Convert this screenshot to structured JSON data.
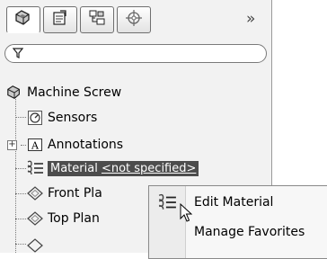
{
  "tabs": [
    {
      "icon": "feature-manager-icon",
      "active": true
    },
    {
      "icon": "property-manager-icon",
      "active": false
    },
    {
      "icon": "configuration-manager-icon",
      "active": false
    },
    {
      "icon": "dim-xpert-icon",
      "active": false
    }
  ],
  "overflow_label": "»",
  "filter": {
    "icon": "filter-icon",
    "value": ""
  },
  "tree": {
    "root": "Machine Screw",
    "items": [
      {
        "label": "Sensors",
        "icon": "sensors-icon"
      },
      {
        "label": "Annotations",
        "icon": "annotations-icon"
      },
      {
        "label": "Material",
        "suffix": "<not specified>",
        "icon": "material-icon"
      },
      {
        "label": "Front Pla",
        "icon": "plane-icon"
      },
      {
        "label": "Top Plan",
        "icon": "plane-icon"
      }
    ]
  },
  "context_menu": {
    "items": [
      {
        "label": "Edit Material",
        "icon": "material-icon"
      },
      {
        "label": "Manage Favorites",
        "icon": ""
      }
    ]
  }
}
